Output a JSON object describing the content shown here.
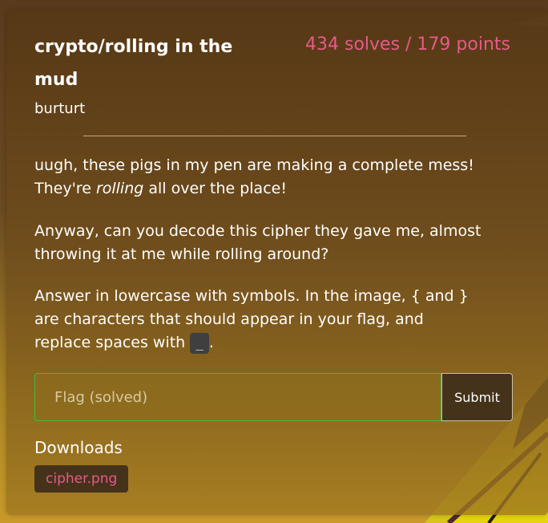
{
  "challenge": {
    "title": "crypto/rolling in the mud",
    "stats": "434 solves / 179 points",
    "author": "burturt",
    "description": {
      "p1_before": "uugh, these pigs in my pen are making a complete mess! They're ",
      "p1_emphasis": "rolling",
      "p1_after": " all over the place!",
      "p2": "Anyway, can you decode this cipher they gave me, almost throwing it at me while rolling around?",
      "p3_before": "Answer in lowercase with symbols. In the image, { and } are characters that should appear in your flag, and replace spaces with ",
      "p3_code": "_",
      "p3_after": "."
    }
  },
  "flag_form": {
    "placeholder": "Flag (solved)",
    "value": "",
    "submit_label": "Submit"
  },
  "downloads": {
    "heading": "Downloads",
    "files": [
      "cipher.png"
    ]
  },
  "colors": {
    "accent_pink": "#e65a8a",
    "input_border_green": "#3fbf3f",
    "dark_button": "#45321a"
  }
}
